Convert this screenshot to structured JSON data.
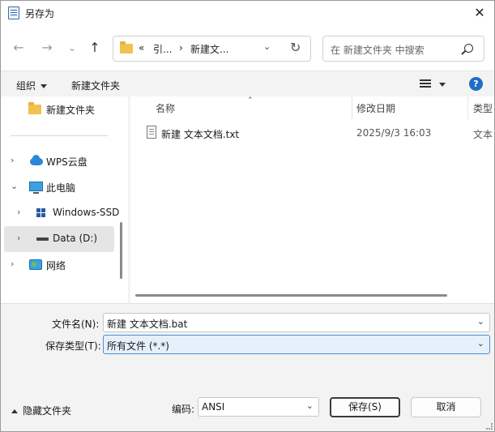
{
  "window": {
    "title": "另存为"
  },
  "nav": {
    "back_icon": "←",
    "forward_icon": "→",
    "recent_icon": "⌄",
    "up_icon": "↑",
    "address": {
      "overflow": "«",
      "segment1": "引...",
      "separator": "›",
      "segment2": "新建文..."
    },
    "search_placeholder": "在 新建文件夹 中搜索"
  },
  "toolbar": {
    "organize": "组织",
    "new_folder": "新建文件夹",
    "help": "?"
  },
  "sidebar": {
    "items": [
      {
        "label": "新建文件夹",
        "chevron": "",
        "icon": "folder-icon"
      },
      {
        "label": "WPS云盘",
        "chevron": "›",
        "icon": "cloud-icon"
      },
      {
        "label": "此电脑",
        "chevron": "⌄",
        "icon": "computer-icon"
      },
      {
        "label": "Windows-SSD",
        "chevron": "›",
        "icon": "windows-drive-icon"
      },
      {
        "label": "Data (D:)",
        "chevron": "›",
        "icon": "drive-icon"
      },
      {
        "label": "网络",
        "chevron": "›",
        "icon": "network-icon"
      }
    ]
  },
  "filelist": {
    "columns": {
      "name": "名称",
      "modified": "修改日期",
      "type": "类型"
    },
    "files": [
      {
        "name": "新建 文本文档.txt",
        "modified": "2025/9/3 16:03",
        "type": "文本"
      }
    ]
  },
  "form": {
    "filename_label": "文件名(N):",
    "filename_value": "新建 文本文档.bat",
    "filetype_label": "保存类型(T):",
    "filetype_value": "所有文件  (*.*)"
  },
  "footer": {
    "hide_folders": "隐藏文件夹",
    "encoding_label": "编码:",
    "encoding_value": "ANSI",
    "save": "保存(S)",
    "cancel": "取消"
  }
}
